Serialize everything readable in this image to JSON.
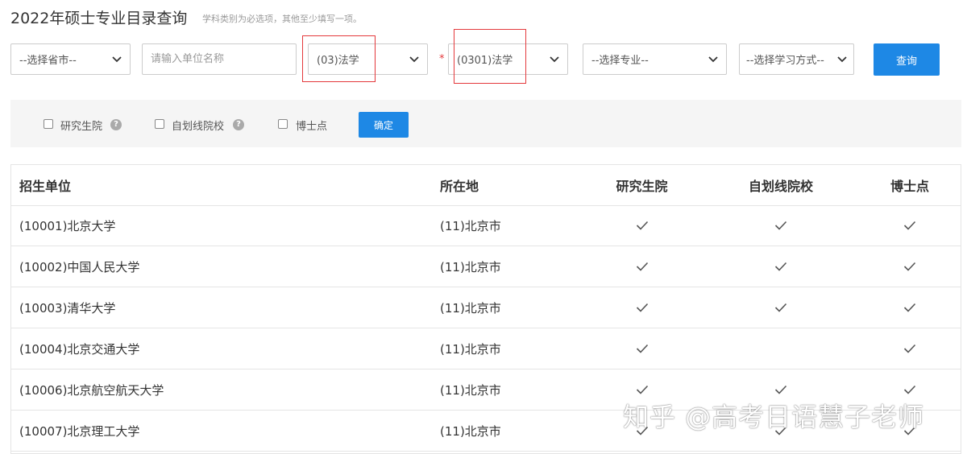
{
  "header": {
    "title": "2022年硕士专业目录查询",
    "note": "学科类别为必选项，其他至少填写一项。"
  },
  "search": {
    "province_select": "--选择省市--",
    "unit_placeholder": "请输入单位名称",
    "category_select": "(03)法学",
    "required_mark": "*",
    "discipline_select": "(0301)法学",
    "major_select": "--选择专业--",
    "study_mode_select": "--选择学习方式--",
    "query_button": "查询"
  },
  "filters": {
    "graduate_school_label": "研究生院",
    "self_line_label": "自划线院校",
    "doctoral_label": "博士点",
    "help_glyph": "?",
    "confirm_button": "确定"
  },
  "table": {
    "headers": [
      "招生单位",
      "所在地",
      "研究生院",
      "自划线院校",
      "博士点"
    ],
    "rows": [
      {
        "unit": "(10001)北京大学",
        "location": "(11)北京市",
        "graduate_school": true,
        "self_line": true,
        "doctoral": true
      },
      {
        "unit": "(10002)中国人民大学",
        "location": "(11)北京市",
        "graduate_school": true,
        "self_line": true,
        "doctoral": true
      },
      {
        "unit": "(10003)清华大学",
        "location": "(11)北京市",
        "graduate_school": true,
        "self_line": true,
        "doctoral": true
      },
      {
        "unit": "(10004)北京交通大学",
        "location": "(11)北京市",
        "graduate_school": true,
        "self_line": false,
        "doctoral": true
      },
      {
        "unit": "(10006)北京航空航天大学",
        "location": "(11)北京市",
        "graduate_school": true,
        "self_line": true,
        "doctoral": true
      },
      {
        "unit": "(10007)北京理工大学",
        "location": "(11)北京市",
        "graduate_school": true,
        "self_line": true,
        "doctoral": true
      }
    ]
  },
  "watermark": "知乎 @高考日语慧子老师",
  "colors": {
    "primary_button": "#1e88e5",
    "highlight_border": "#e4393c",
    "required_mark": "#e4393c",
    "filter_bg": "#f5f5f5"
  }
}
